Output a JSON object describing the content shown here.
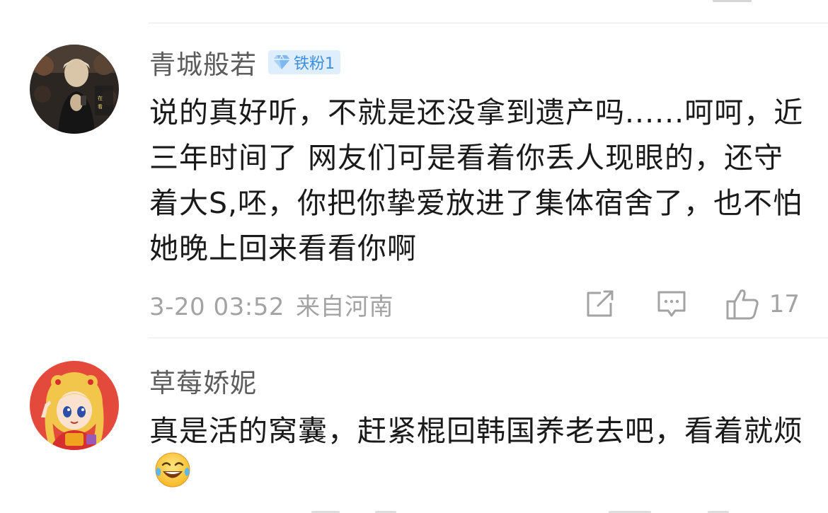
{
  "comments": [
    {
      "username": "青城般若",
      "badge": "铁粉1",
      "text": "说的真好听，不就是还没拿到遗产吗......呵呵，近三年时间了 网友们可是看着你丢人现眼的，还守着大S,呸，你把你挚爱放进了集体宿舍了，也不怕她晚上回来看看你啊",
      "date": "3-20 03:52",
      "location": "来自河南",
      "likes": "17"
    },
    {
      "username": "草莓娇妮",
      "text": "真是活的窝囊，赶紧棍回韩国养老去吧，看着就烦",
      "emoji": "laughing-tears-emoji"
    }
  ],
  "colors": {
    "username": "#5c5c5c",
    "text": "#1a1a1a",
    "meta": "#a3a3a3",
    "badge_bg": "#dfeefd",
    "badge_text": "#3d8fe0",
    "divider": "#e8e8e8"
  },
  "icons": {
    "share": "share-icon",
    "reply": "comment-icon",
    "like": "thumbs-up-icon",
    "badge": "diamond-icon"
  }
}
